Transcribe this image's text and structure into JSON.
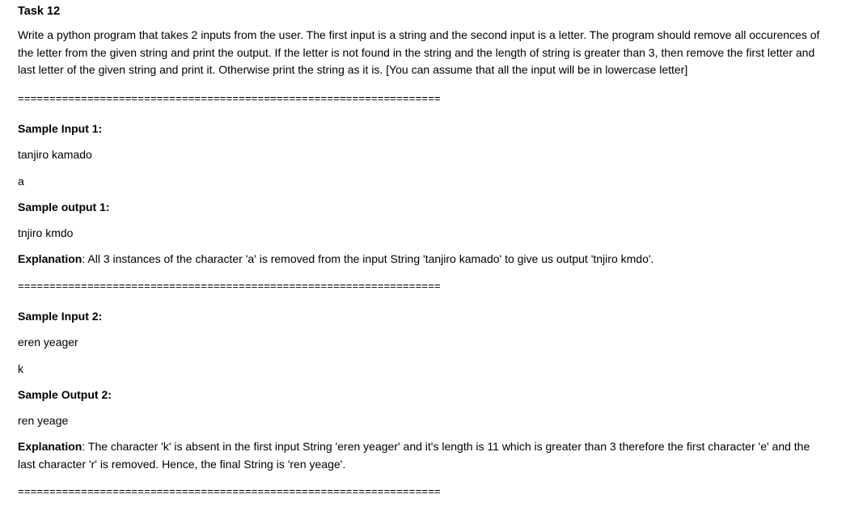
{
  "task": {
    "title": "Task 12",
    "prompt": "Write a python program that takes 2 inputs from the user. The first input is a string and the second input is a letter. The program should remove all occurences of the letter from the given string and print the output. If the letter is not found in the string and the length of string is greater than 3, then remove the first letter and last letter of the given string and print it. Otherwise print the string as it is. [You can assume that all the input will be in lowercase letter]"
  },
  "separator": "===================================================================",
  "sample1": {
    "input_label": "Sample Input 1:",
    "input_string": "tanjiro kamado",
    "input_letter": "a",
    "output_label": "Sample output 1:",
    "output_value": "tnjiro kmdo",
    "explanation_label": "Explanation",
    "explanation_text": ": All 3 instances of the character 'a' is removed from the input String 'tanjiro kamado' to give us output 'tnjiro kmdo'."
  },
  "sample2": {
    "input_label": "Sample Input 2:",
    "input_string": "eren yeager",
    "input_letter": "k",
    "output_label": "Sample Output 2:",
    "output_value": "ren yeage",
    "explanation_label": "Explanation",
    "explanation_text": ": The character 'k' is absent in the first input String 'eren yeager' and it's length is 11 which is greater than 3 therefore the first character 'e' and the last character 'r' is removed. Hence, the final String is 'ren yeage'."
  }
}
